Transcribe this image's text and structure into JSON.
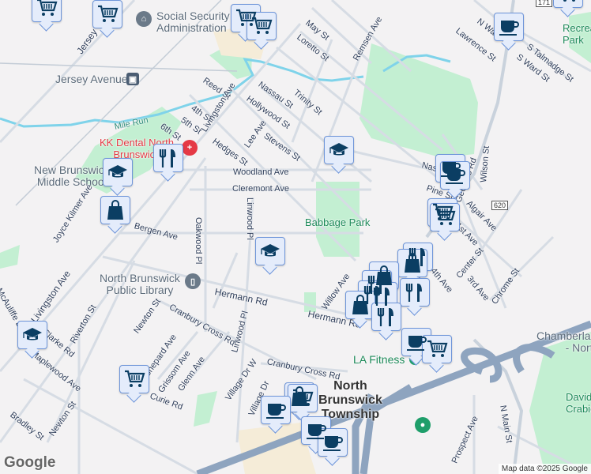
{
  "labels": {
    "social_security": "Social Security\nAdministration",
    "jersey_avenue_station": "Jersey Avenue",
    "jersey": "Jersey",
    "mile_run": "Mile Run",
    "kk_dental": "KK Dental North\nBrunswick",
    "nb_middle_school": "New Brunswick\nMiddle School",
    "reed_st": "Reed St",
    "fourth_st": "4th St",
    "fifth_st": "5th St",
    "sixth_st": "6th St",
    "livingston_ave_n": "Livingston Ave",
    "hedges_st": "Hedges St",
    "lee_ave": "Lee Ave",
    "hollywood_st": "Hollywood St",
    "nassau_st": "Nassau St",
    "stevens_st": "Stevens St",
    "woodland_ave": "Woodland Ave",
    "cleremont_ave": "Cleremont Ave",
    "oakwood_pl": "Oakwood Pl",
    "linwood_pl_n": "Linwood Pl",
    "bergen_ave": "Bergen Ave",
    "joyce_kilmer_ave": "Joyce Kilmer Ave",
    "may_st": "May St",
    "loretto_st": "Loretto St",
    "remsen_ave": "Remsen Ave",
    "trinity_st": "Trinity St",
    "lawrence_st": "Lawrence St",
    "n_ward_st": "N Ward St",
    "s_talmadge_st": "S Talmadge St",
    "s_ward_st": "S Ward St",
    "recreation_park": "Recreation\nPark",
    "wilson_st": "Wilson St",
    "nassau_st_e": "Nassau St",
    "georges_rd": "Georges Rd",
    "pine_st": "Pine St",
    "algair_ave": "Algair Ave",
    "first_ave": "1st Ave",
    "route_620": "620",
    "route_171": "171",
    "babbage_park": "Babbage Park",
    "nb_public_library": "North Brunswick\nPublic Library",
    "hermann_rd_w": "Hermann Rd",
    "hermann_rd_e": "Hermann Rd",
    "livingston_ave_s": "Livingston Ave",
    "mcauliffe_dr": "McAuliffe Dr",
    "clarke_rd": "Clarke Rd",
    "riverton_st": "Riverton St",
    "newton_st_n": "Newton St",
    "cranbury_cross_rd_w": "Cranbury Cross Rd",
    "linwood_pl_s": "Linwood Pl",
    "shepard_ave": "Shepard Ave",
    "grissom_ave": "Grissom Ave",
    "glenn_ave": "Glenn Ave",
    "curie_rd": "Curie Rd",
    "village_dr_w": "Village Dr W",
    "village_dr": "Village Dr",
    "cranbury_cross_rd_e": "Cranbury Cross Rd",
    "maplewood_ave": "Maplewood Ave",
    "bradley_st": "Bradley St",
    "newton_st_s": "Newton St",
    "willow_ave": "Willow Ave",
    "fourth_ave": "4th Ave",
    "center_st": "Center St",
    "third_ave": "3rd Ave",
    "chrome_st": "Chrome St",
    "chamberlain": "Chamberlain\n- North",
    "la_fitness": "LA Fitness",
    "nb_township": "North\nBrunswick\nTownship",
    "prospect_ave": "Prospect Ave",
    "n_main_st": "N Main St",
    "davidson_crabiel": "Davidson\nCrabiel"
  },
  "footer": {
    "logo": "Google",
    "attribution": "Map data ©2025 Google"
  },
  "colors": {
    "marker_bg": "#e4ecfb",
    "marker_border": "#6e95d9",
    "icon": "#0b3e63",
    "park": "#c3efd2",
    "water": "#7fd3ea",
    "highway": "#8ea4bf"
  },
  "marker_types": [
    "grocery-cart",
    "coffee-cup",
    "school",
    "restaurant",
    "shopping-bag"
  ]
}
